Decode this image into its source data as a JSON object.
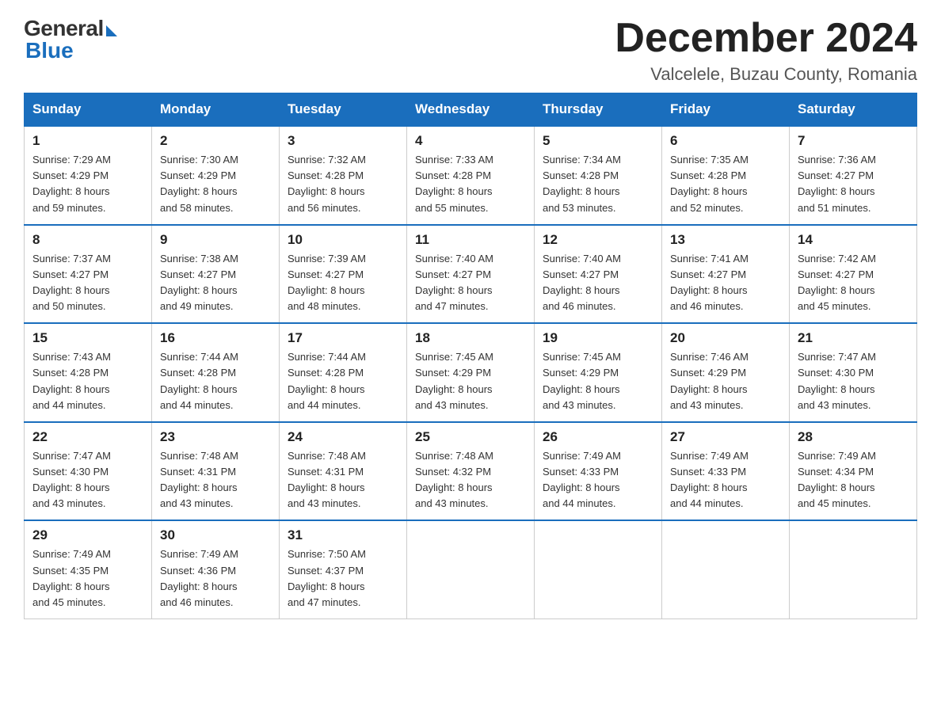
{
  "logo": {
    "general": "General",
    "blue": "Blue"
  },
  "header": {
    "month": "December 2024",
    "location": "Valcelele, Buzau County, Romania"
  },
  "weekdays": [
    "Sunday",
    "Monday",
    "Tuesday",
    "Wednesday",
    "Thursday",
    "Friday",
    "Saturday"
  ],
  "weeks": [
    [
      {
        "day": "1",
        "sunrise": "7:29 AM",
        "sunset": "4:29 PM",
        "daylight": "8 hours and 59 minutes."
      },
      {
        "day": "2",
        "sunrise": "7:30 AM",
        "sunset": "4:29 PM",
        "daylight": "8 hours and 58 minutes."
      },
      {
        "day": "3",
        "sunrise": "7:32 AM",
        "sunset": "4:28 PM",
        "daylight": "8 hours and 56 minutes."
      },
      {
        "day": "4",
        "sunrise": "7:33 AM",
        "sunset": "4:28 PM",
        "daylight": "8 hours and 55 minutes."
      },
      {
        "day": "5",
        "sunrise": "7:34 AM",
        "sunset": "4:28 PM",
        "daylight": "8 hours and 53 minutes."
      },
      {
        "day": "6",
        "sunrise": "7:35 AM",
        "sunset": "4:28 PM",
        "daylight": "8 hours and 52 minutes."
      },
      {
        "day": "7",
        "sunrise": "7:36 AM",
        "sunset": "4:27 PM",
        "daylight": "8 hours and 51 minutes."
      }
    ],
    [
      {
        "day": "8",
        "sunrise": "7:37 AM",
        "sunset": "4:27 PM",
        "daylight": "8 hours and 50 minutes."
      },
      {
        "day": "9",
        "sunrise": "7:38 AM",
        "sunset": "4:27 PM",
        "daylight": "8 hours and 49 minutes."
      },
      {
        "day": "10",
        "sunrise": "7:39 AM",
        "sunset": "4:27 PM",
        "daylight": "8 hours and 48 minutes."
      },
      {
        "day": "11",
        "sunrise": "7:40 AM",
        "sunset": "4:27 PM",
        "daylight": "8 hours and 47 minutes."
      },
      {
        "day": "12",
        "sunrise": "7:40 AM",
        "sunset": "4:27 PM",
        "daylight": "8 hours and 46 minutes."
      },
      {
        "day": "13",
        "sunrise": "7:41 AM",
        "sunset": "4:27 PM",
        "daylight": "8 hours and 46 minutes."
      },
      {
        "day": "14",
        "sunrise": "7:42 AM",
        "sunset": "4:27 PM",
        "daylight": "8 hours and 45 minutes."
      }
    ],
    [
      {
        "day": "15",
        "sunrise": "7:43 AM",
        "sunset": "4:28 PM",
        "daylight": "8 hours and 44 minutes."
      },
      {
        "day": "16",
        "sunrise": "7:44 AM",
        "sunset": "4:28 PM",
        "daylight": "8 hours and 44 minutes."
      },
      {
        "day": "17",
        "sunrise": "7:44 AM",
        "sunset": "4:28 PM",
        "daylight": "8 hours and 44 minutes."
      },
      {
        "day": "18",
        "sunrise": "7:45 AM",
        "sunset": "4:29 PM",
        "daylight": "8 hours and 43 minutes."
      },
      {
        "day": "19",
        "sunrise": "7:45 AM",
        "sunset": "4:29 PM",
        "daylight": "8 hours and 43 minutes."
      },
      {
        "day": "20",
        "sunrise": "7:46 AM",
        "sunset": "4:29 PM",
        "daylight": "8 hours and 43 minutes."
      },
      {
        "day": "21",
        "sunrise": "7:47 AM",
        "sunset": "4:30 PM",
        "daylight": "8 hours and 43 minutes."
      }
    ],
    [
      {
        "day": "22",
        "sunrise": "7:47 AM",
        "sunset": "4:30 PM",
        "daylight": "8 hours and 43 minutes."
      },
      {
        "day": "23",
        "sunrise": "7:48 AM",
        "sunset": "4:31 PM",
        "daylight": "8 hours and 43 minutes."
      },
      {
        "day": "24",
        "sunrise": "7:48 AM",
        "sunset": "4:31 PM",
        "daylight": "8 hours and 43 minutes."
      },
      {
        "day": "25",
        "sunrise": "7:48 AM",
        "sunset": "4:32 PM",
        "daylight": "8 hours and 43 minutes."
      },
      {
        "day": "26",
        "sunrise": "7:49 AM",
        "sunset": "4:33 PM",
        "daylight": "8 hours and 44 minutes."
      },
      {
        "day": "27",
        "sunrise": "7:49 AM",
        "sunset": "4:33 PM",
        "daylight": "8 hours and 44 minutes."
      },
      {
        "day": "28",
        "sunrise": "7:49 AM",
        "sunset": "4:34 PM",
        "daylight": "8 hours and 45 minutes."
      }
    ],
    [
      {
        "day": "29",
        "sunrise": "7:49 AM",
        "sunset": "4:35 PM",
        "daylight": "8 hours and 45 minutes."
      },
      {
        "day": "30",
        "sunrise": "7:49 AM",
        "sunset": "4:36 PM",
        "daylight": "8 hours and 46 minutes."
      },
      {
        "day": "31",
        "sunrise": "7:50 AM",
        "sunset": "4:37 PM",
        "daylight": "8 hours and 47 minutes."
      },
      null,
      null,
      null,
      null
    ]
  ],
  "labels": {
    "sunrise": "Sunrise:",
    "sunset": "Sunset:",
    "daylight": "Daylight:"
  }
}
